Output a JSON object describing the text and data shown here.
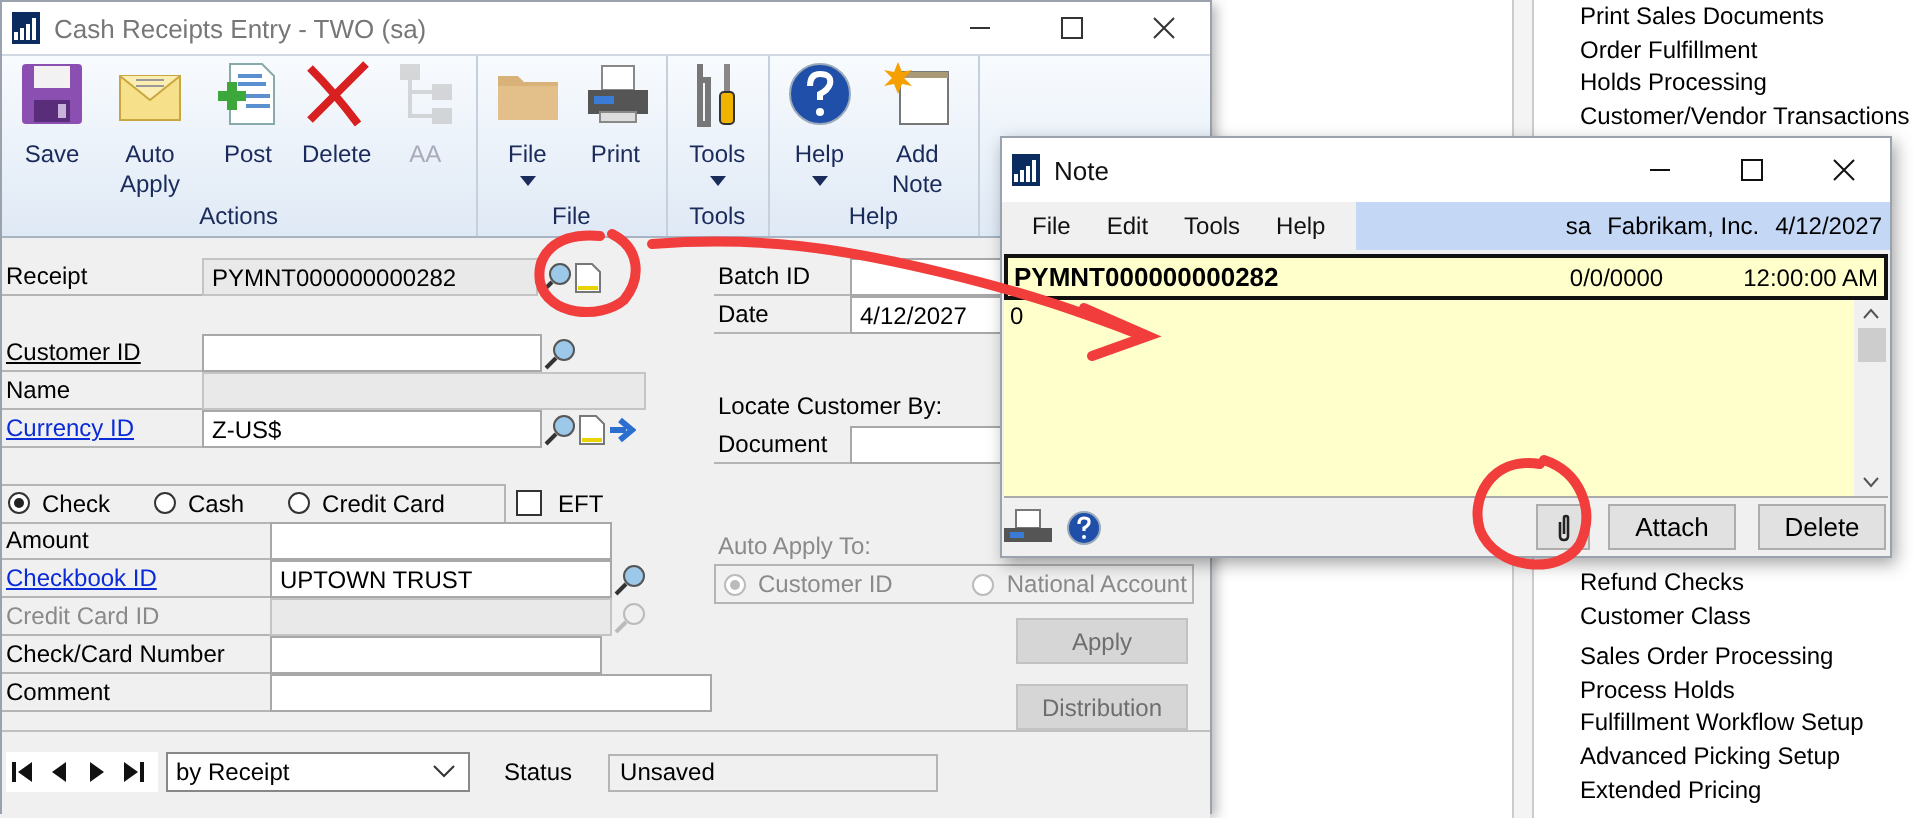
{
  "window": {
    "title": "Cash Receipts Entry  -  TWO (sa)"
  },
  "ribbon": {
    "groups": [
      {
        "label": "Actions",
        "buttons": [
          {
            "label": "Save",
            "kind": "save",
            "disabled": false,
            "dropdown": false
          },
          {
            "label": "Auto Apply",
            "kind": "envelope",
            "disabled": false,
            "dropdown": false
          },
          {
            "label": "Post",
            "kind": "post",
            "disabled": false,
            "dropdown": false
          },
          {
            "label": "Delete",
            "kind": "delete",
            "disabled": false,
            "dropdown": false
          },
          {
            "label": "AA",
            "kind": "tree",
            "disabled": true,
            "dropdown": false
          }
        ]
      },
      {
        "label": "File",
        "buttons": [
          {
            "label": "File",
            "kind": "folder",
            "disabled": false,
            "dropdown": true
          },
          {
            "label": "Print",
            "kind": "printer",
            "disabled": false,
            "dropdown": false
          }
        ]
      },
      {
        "label": "Tools",
        "buttons": [
          {
            "label": "Tools",
            "kind": "tools",
            "disabled": false,
            "dropdown": true
          }
        ]
      },
      {
        "label": "Help",
        "buttons": [
          {
            "label": "Help",
            "kind": "help",
            "disabled": false,
            "dropdown": true
          },
          {
            "label": "Add Note",
            "kind": "note",
            "disabled": false,
            "dropdown": false
          }
        ]
      }
    ]
  },
  "customer_fields": [
    {
      "label": "Receipt",
      "kind": "plain",
      "value": "PYMNT000000000282",
      "editable": false
    },
    {
      "label": "Customer ID",
      "kind": "lookup",
      "editable": true
    },
    {
      "label": "Name",
      "kind": "plain",
      "editable": false
    },
    {
      "label": "Currency ID",
      "kind": "link",
      "value": "Z-US$",
      "editable": true
    }
  ],
  "payment_type": {
    "options": [
      {
        "label": "Check",
        "selected": true
      },
      {
        "label": "Cash",
        "selected": false
      },
      {
        "label": "Credit Card",
        "selected": false
      }
    ],
    "eft": {
      "label": "EFT",
      "checked": false
    }
  },
  "payment_fields": [
    {
      "label": "Amount",
      "kind": "plain",
      "editable": true,
      "disabled": false
    },
    {
      "label": "Checkbook ID",
      "kind": "link",
      "value": "UPTOWN TRUST",
      "editable": true,
      "disabled": false
    },
    {
      "label": "Credit Card ID",
      "kind": "plain",
      "editable": false,
      "disabled": true
    },
    {
      "label": "Check/Card Number",
      "kind": "plain",
      "editable": true,
      "disabled": false
    },
    {
      "label": "Comment",
      "kind": "plain",
      "editable": true,
      "disabled": false
    }
  ],
  "batch_fields": [
    {
      "label": "Batch ID",
      "editable": true
    },
    {
      "label": "Date",
      "value": "4/12/2027",
      "editable": true
    }
  ],
  "locate": {
    "heading": "Locate Customer By:",
    "field": {
      "label": "Document",
      "editable": true
    }
  },
  "auto_apply": {
    "label": "Auto Apply To:",
    "disabled": true,
    "options": [
      {
        "label": "Customer ID",
        "selected": true
      },
      {
        "label": "National Account",
        "selected": false
      }
    ]
  },
  "action_buttons": [
    {
      "label": "Apply",
      "disabled": true
    },
    {
      "label": "Distribution",
      "disabled": true
    }
  ],
  "footer": {
    "sort": "by Receipt",
    "status_label": "Status",
    "status": "Unsaved"
  },
  "note": {
    "title": "Note",
    "menu": [
      "File",
      "Edit",
      "Tools",
      "Help"
    ],
    "user": "sa",
    "company": "Fabrikam, Inc.",
    "date": "4/12/2027",
    "header": {
      "id": "PYMNT000000000282",
      "date": "0/0/0000",
      "time": "12:00:00 AM"
    },
    "body": "0",
    "buttons": [
      "Attach",
      "Delete"
    ]
  },
  "navigation_list": {
    "sections": [
      [
        "Print Sales Documents",
        "Order Fulfillment",
        "Holds Processing",
        "Customer/Vendor Transactions"
      ],
      [
        "Refund Checks",
        "Customer Class"
      ],
      [
        "Sales Order Processing",
        "Process Holds",
        "Fulfillment Workflow Setup",
        "Advanced Picking Setup",
        "Extended Pricing"
      ]
    ]
  }
}
